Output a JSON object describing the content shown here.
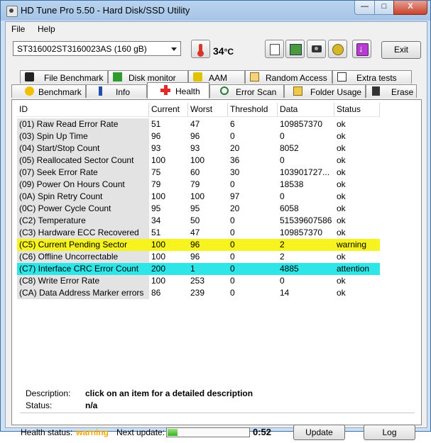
{
  "window": {
    "title": "HD Tune Pro 5.50 - Hard Disk/SSD Utility",
    "controls": {
      "minimize": "—",
      "maximize": "□",
      "close": "X"
    }
  },
  "menu": {
    "file": "File",
    "help": "Help"
  },
  "toolbar": {
    "drive": "ST316002ST3160023AS (160 gB)",
    "temperature": "34",
    "temp_unit": "°C",
    "exit_label": "Exit",
    "icons": [
      "thermometer-icon",
      "copy-text-icon",
      "copy-screen-icon",
      "camera-icon",
      "settings-icon",
      "save-icon"
    ]
  },
  "tabs": {
    "row1": [
      "File Benchmark",
      "Disk monitor",
      "AAM",
      "Random Access",
      "Extra tests"
    ],
    "row2": [
      "Benchmark",
      "Info",
      "Health",
      "Error Scan",
      "Folder Usage",
      "Erase"
    ],
    "active": "Health"
  },
  "table": {
    "headers": [
      "ID",
      "Current",
      "Worst",
      "Threshold",
      "Data",
      "Status"
    ],
    "rows": [
      [
        "(01) Raw Read Error Rate",
        "51",
        "47",
        "6",
        "109857370",
        "ok"
      ],
      [
        "(03) Spin Up Time",
        "96",
        "96",
        "0",
        "0",
        "ok"
      ],
      [
        "(04) Start/Stop Count",
        "93",
        "93",
        "20",
        "8052",
        "ok"
      ],
      [
        "(05) Reallocated Sector Count",
        "100",
        "100",
        "36",
        "0",
        "ok"
      ],
      [
        "(07) Seek Error Rate",
        "75",
        "60",
        "30",
        "103901727...",
        "ok"
      ],
      [
        "(09) Power On Hours Count",
        "79",
        "79",
        "0",
        "18538",
        "ok"
      ],
      [
        "(0A) Spin Retry Count",
        "100",
        "100",
        "97",
        "0",
        "ok"
      ],
      [
        "(0C) Power Cycle Count",
        "95",
        "95",
        "20",
        "6058",
        "ok"
      ],
      [
        "(C2) Temperature",
        "34",
        "50",
        "0",
        "51539607586",
        "ok"
      ],
      [
        "(C3) Hardware ECC Recovered",
        "51",
        "47",
        "0",
        "109857370",
        "ok"
      ],
      [
        "(C5) Current Pending Sector",
        "100",
        "96",
        "0",
        "2",
        "warning"
      ],
      [
        "(C6) Offline Uncorrectable",
        "100",
        "96",
        "0",
        "2",
        "ok"
      ],
      [
        "(C7) Interface CRC Error Count",
        "200",
        "1",
        "0",
        "4885",
        "attention"
      ],
      [
        "(C8) Write Error Rate",
        "100",
        "253",
        "0",
        "0",
        "ok"
      ],
      [
        "(CA) Data Address Marker errors",
        "86",
        "239",
        "0",
        "14",
        "ok"
      ]
    ],
    "row_highlight": {
      "warning": "#f7f31f",
      "attention": "#2ee5e7"
    }
  },
  "details": {
    "description_label": "Description:",
    "description_value": "click on an item for a detailed description",
    "status_label": "Status:",
    "status_value": "n/a"
  },
  "footer": {
    "health_label": "Health status:",
    "health_value": "warning",
    "health_color": "#f2a900",
    "next_update_label": "Next update:",
    "progress_fraction": 0.12,
    "countdown": "0:52",
    "update_label": "Update",
    "log_label": "Log"
  }
}
